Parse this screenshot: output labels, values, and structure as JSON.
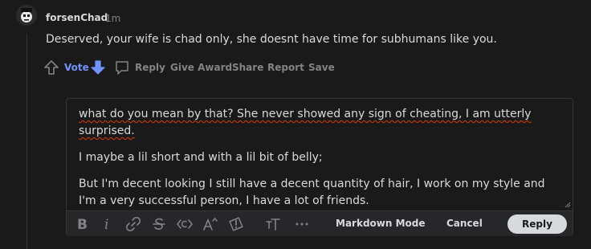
{
  "comment": {
    "author": "forsenChad",
    "separator": "·",
    "time": "1m",
    "body": "Deserved, your wife is chad only, she doesnt have time for subhumans like you."
  },
  "actions": {
    "vote": "Vote",
    "reply": "Reply",
    "give_award": "Give Award",
    "share": "Share",
    "report": "Report",
    "save": "Save"
  },
  "editor": {
    "paragraph_1": "what do you mean by that? She never showed any sign of cheating, I am utterly surprised.",
    "paragraph_2": "I maybe a lil short and with a lil bit of belly;",
    "paragraph_3": "But I'm decent looking I still have a decent quantity of hair, I work on my style and I'm a very successful person, I have a lot of friends.",
    "markdown_mode": "Markdown Mode",
    "cancel": "Cancel",
    "reply": "Reply",
    "toolbar_icons": [
      "bold-icon",
      "italic-icon",
      "link-icon",
      "strikethrough-icon",
      "inline-code-icon",
      "superscript-icon",
      "spoiler-icon",
      "heading-icon",
      "more-icon"
    ]
  },
  "colors": {
    "background": "#1a1a1b",
    "text": "#d7dadc",
    "muted": "#818384",
    "vote_accent": "#7193ff",
    "downvote_active": "#7193ff"
  }
}
